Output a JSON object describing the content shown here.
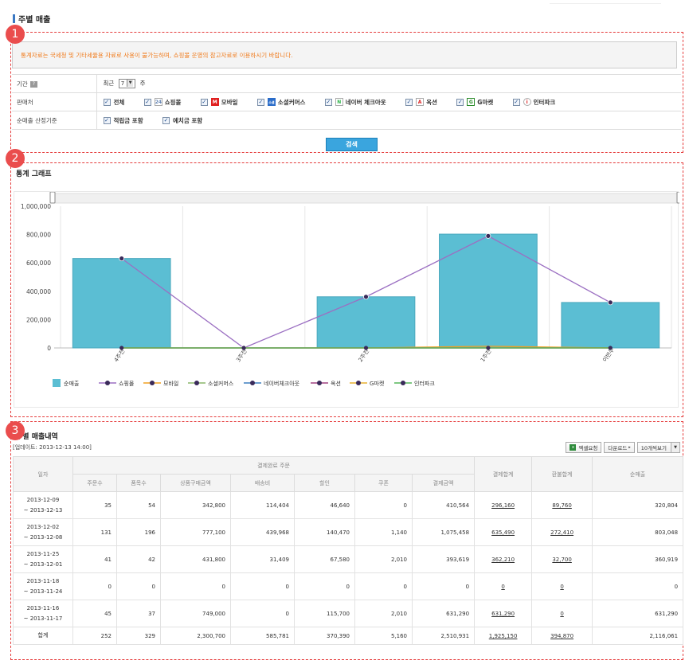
{
  "page_title": "주별 매출",
  "markers": [
    "1",
    "2",
    "3"
  ],
  "notice": "통계자료는 국세청 및 기타세율용 자료로 사용이 불가능하며, 쇼핑몰 운영의 참고자료로 이용하시기 바랍니다.",
  "filter": {
    "period_label": "기간",
    "help_icon_text": "?",
    "period_prefix": "최근",
    "period_value": "7",
    "period_suffix": "주",
    "seller_label": "판매처",
    "sellers": [
      {
        "label": "전체",
        "icon": ""
      },
      {
        "label": "쇼핑몰",
        "icon": "24"
      },
      {
        "label": "모바일",
        "icon": "M"
      },
      {
        "label": "소셜커머스",
        "icon": "소셜"
      },
      {
        "label": "네이버 체크아웃",
        "icon": "N"
      },
      {
        "label": "옥션",
        "icon": "A"
      },
      {
        "label": "G마켓",
        "icon": "G"
      },
      {
        "label": "인터파크",
        "icon": "i"
      }
    ],
    "net_label": "순매출 산정기준",
    "net_options": [
      "적립금 포함",
      "예치금 포함"
    ]
  },
  "search_button": "검색",
  "graph_title": "통계 그래프",
  "chart_data": {
    "type": "bar",
    "categories": [
      "4주전",
      "3주전",
      "2주전",
      "1주전",
      "이번주"
    ],
    "ylim": [
      0,
      1000000
    ],
    "y_ticks": [
      "0",
      "200,000",
      "400,000",
      "600,000",
      "800,000",
      "1,000,000"
    ],
    "bar_color": "#5bbed3",
    "series": [
      {
        "name": "순매출",
        "kind": "bar",
        "color": "#5bbed3",
        "values": [
          631290,
          0,
          360919,
          803048,
          320804
        ]
      },
      {
        "name": "쇼핑몰",
        "kind": "line",
        "color": "#9b6fc2",
        "values": [
          631290,
          0,
          360919,
          790000,
          320804
        ]
      },
      {
        "name": "모바일",
        "kind": "line",
        "color": "#f0a020",
        "values": [
          0,
          0,
          0,
          12000,
          0
        ]
      },
      {
        "name": "소셜커머스",
        "kind": "line",
        "color": "#8ab56a",
        "values": [
          0,
          0,
          0,
          0,
          0
        ]
      },
      {
        "name": "네이버체크아웃",
        "kind": "line",
        "color": "#3d7fbf",
        "values": [
          0,
          0,
          0,
          0,
          0
        ]
      },
      {
        "name": "옥션",
        "kind": "line",
        "color": "#a04080",
        "values": [
          0,
          0,
          0,
          0,
          0
        ]
      },
      {
        "name": "G마켓",
        "kind": "line",
        "color": "#e8b030",
        "values": [
          0,
          0,
          0,
          0,
          0
        ]
      },
      {
        "name": "인터파크",
        "kind": "line",
        "color": "#53b558",
        "values": [
          0,
          0,
          0,
          0,
          0
        ]
      }
    ]
  },
  "list_title": "주별 매출내역",
  "updated": "[업데이트: 2013-12-13 14:00]",
  "tools": {
    "excel": "엑셀요청",
    "download": "다운로드",
    "page_size": "10개씩보기"
  },
  "table": {
    "group_header": "결제완료 주문",
    "headers": [
      "일자",
      "주문수",
      "품목수",
      "상품구매금액",
      "배송비",
      "할인",
      "쿠폰",
      "결제금액",
      "결제합계",
      "환불합계",
      "순매출"
    ],
    "rows": [
      {
        "date1": "2013-12-09",
        "date2": "~ 2013-12-13",
        "v": [
          "35",
          "54",
          "342,800",
          "114,404",
          "46,640",
          "0",
          "410,564",
          "296,160",
          "89,760",
          "320,804"
        ]
      },
      {
        "date1": "2013-12-02",
        "date2": "~ 2013-12-08",
        "v": [
          "131",
          "196",
          "777,100",
          "439,968",
          "140,470",
          "1,140",
          "1,075,458",
          "635,490",
          "272,410",
          "803,048"
        ]
      },
      {
        "date1": "2013-11-25",
        "date2": "~ 2013-12-01",
        "v": [
          "41",
          "42",
          "431,800",
          "31,409",
          "67,580",
          "2,010",
          "393,619",
          "362,210",
          "32,700",
          "360,919"
        ]
      },
      {
        "date1": "2013-11-18",
        "date2": "~ 2013-11-24",
        "v": [
          "0",
          "0",
          "0",
          "0",
          "0",
          "0",
          "0",
          "0",
          "0",
          "0"
        ]
      },
      {
        "date1": "2013-11-16",
        "date2": "~ 2013-11-17",
        "v": [
          "45",
          "37",
          "749,000",
          "0",
          "115,700",
          "2,010",
          "631,290",
          "631,290",
          "0",
          "631,290"
        ]
      }
    ],
    "total": {
      "label": "합계",
      "v": [
        "252",
        "329",
        "2,300,700",
        "585,781",
        "370,390",
        "5,160",
        "2,510,931",
        "1,925,150",
        "394,870",
        "2,116,061"
      ]
    }
  }
}
